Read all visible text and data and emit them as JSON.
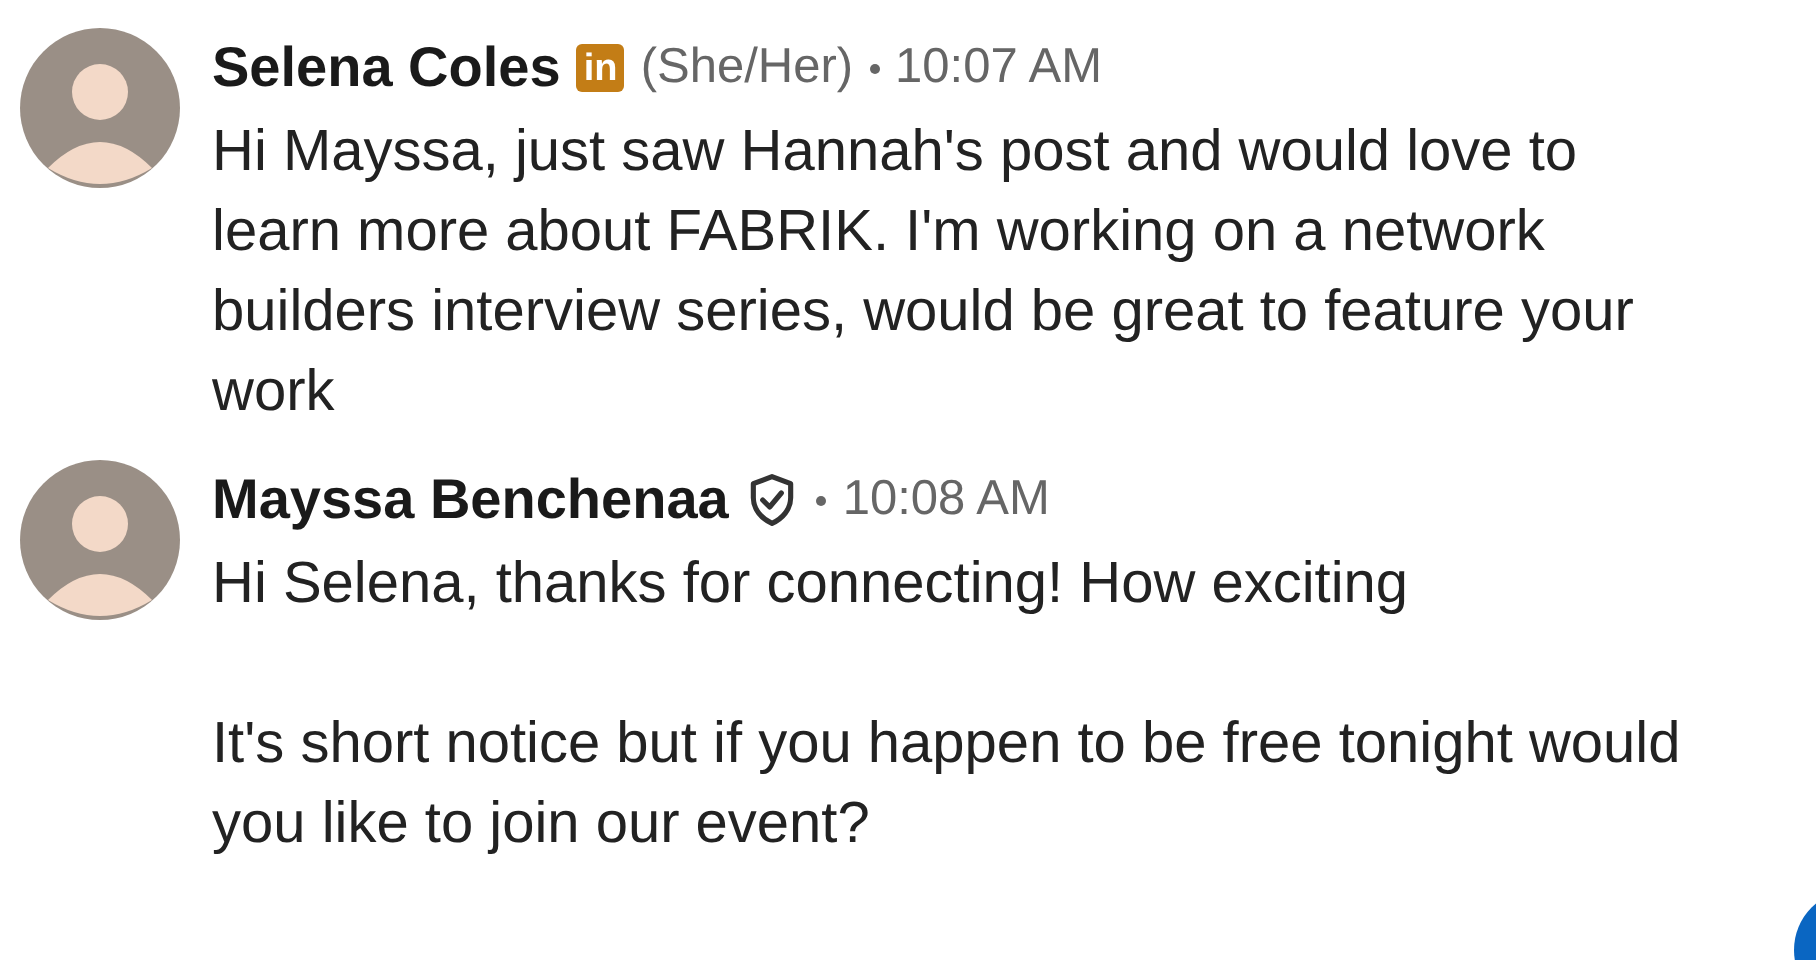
{
  "messages": [
    {
      "author": "Selena Coles",
      "badge": "in",
      "kind": "linkedin",
      "pronouns": "(She/Her)",
      "time": "10:07 AM",
      "paragraphs": [
        "Hi Mayssa, just saw Hannah's post and would love to learn more about FABRIK. I'm working on a network builders interview series, would be great to feature your work"
      ]
    },
    {
      "author": "Mayssa Benchenaa",
      "kind": "verified",
      "time": "10:08 AM",
      "paragraphs": [
        "Hi Selena, thanks for connecting! How exciting",
        "It's short notice but if you happen to be free tonight would you like to join our event?"
      ]
    }
  ]
}
